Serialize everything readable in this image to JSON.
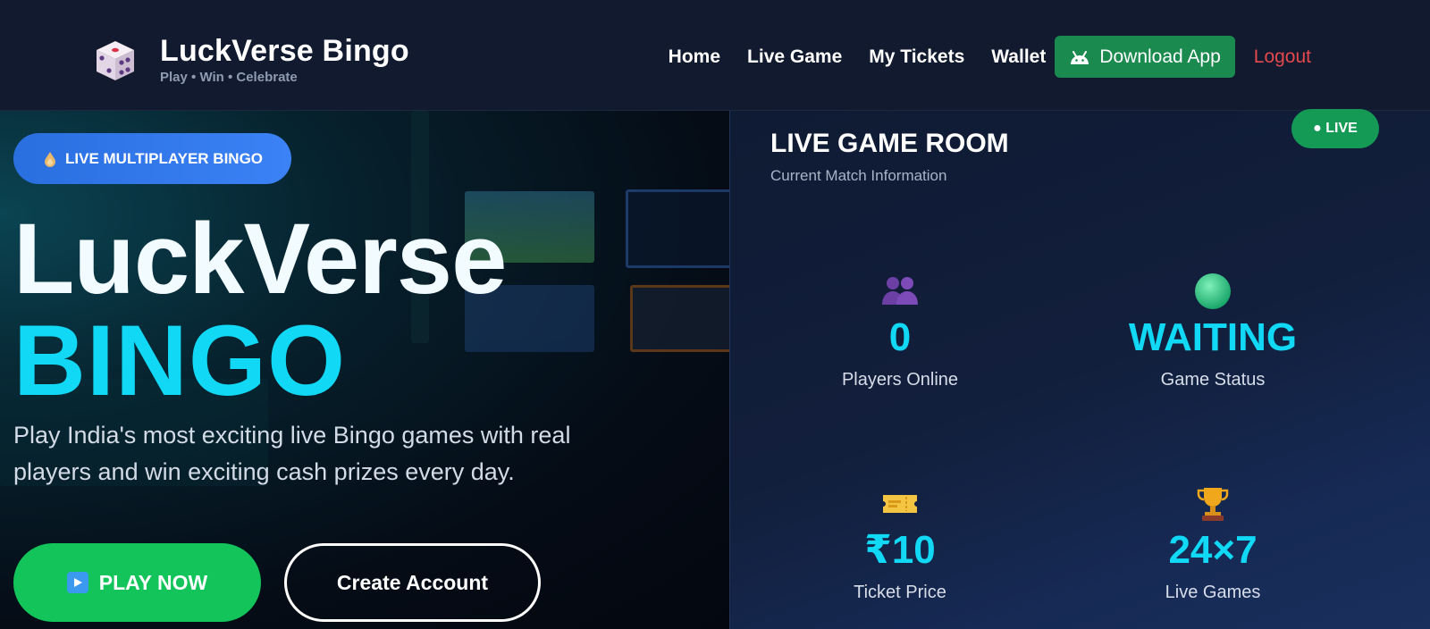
{
  "navbar": {
    "brand_name": "LuckVerse Bingo",
    "brand_tagline": "Play • Win • Celebrate",
    "links": [
      "Home",
      "Live Game",
      "My Tickets",
      "Wallet"
    ],
    "download_label": "Download App",
    "logout_label": "Logout"
  },
  "hero": {
    "badge": "LIVE MULTIPLAYER BINGO",
    "title_line1": "LuckVerse",
    "title_line2": "BINGO",
    "description": "Play India's most exciting live Bingo games with real players and win exciting cash prizes every day.",
    "play_label": "PLAY NOW",
    "create_label": "Create Account"
  },
  "room": {
    "title": "LIVE GAME ROOM",
    "subtitle": "Current Match Information",
    "live_label": "● LIVE",
    "stats": [
      {
        "icon": "players-icon",
        "value": "0",
        "label": "Players Online"
      },
      {
        "icon": "status-dot-icon",
        "value": "WAITING",
        "label": "Game Status"
      },
      {
        "icon": "ticket-icon",
        "value": "₹10",
        "label": "Ticket Price"
      },
      {
        "icon": "trophy-icon",
        "value": "24×7",
        "label": "Live Games"
      }
    ]
  },
  "colors": {
    "accent_cyan": "#10d8f5",
    "play_green": "#12c45a",
    "download_green": "#1a8a4e",
    "logout_red": "#e5484d",
    "badge_blue": "#3b82f6"
  }
}
